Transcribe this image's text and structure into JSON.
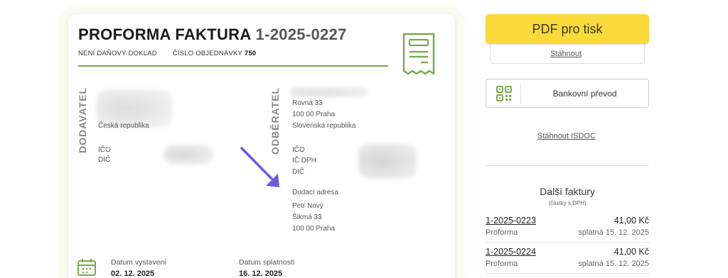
{
  "invoice": {
    "title": "PROFORMA FAKTURA",
    "number": "1-2025-0227",
    "not_tax_doc": "NENÍ DAŇOVÝ DOKLAD",
    "order_label": "ČÍSLO OBJEDNÁVKY",
    "order_number": "750",
    "supplier": {
      "heading": "DODAVATEL",
      "country": "Česká republika",
      "ico_label": "IČO",
      "dic_label": "DIČ"
    },
    "customer": {
      "heading": "ODBĚRATEL",
      "street": "Rovná 33",
      "city": "100 00 Praha",
      "country": "Slovenská republika",
      "ico_label": "IČO",
      "icdph_label": "IČ DPH",
      "dic_label": "DIČ",
      "delivery_label": "Dodací adresa",
      "delivery_name": "Petr Nový",
      "delivery_street": "Šikmá 33",
      "delivery_city": "100 00 Praha"
    },
    "dates": {
      "issued_label": "Datum vystavení",
      "issued_value": "02. 12. 2025",
      "due_label": "Datum splatnosti",
      "due_value": "16. 12. 2025"
    }
  },
  "sidebar": {
    "pdf_button": "PDF pro tisk",
    "download_link": "Stáhnout",
    "bank_button": "Bankovní převod",
    "isdoc_link": "Stáhnout ISDOC",
    "more_title": "Další faktury",
    "more_subtitle": "(částky s DPH)",
    "invoices": [
      {
        "number": "1-2025-0223",
        "amount": "41,00 Kč",
        "type": "Proforma",
        "due": "splatná 15. 12. 2025"
      },
      {
        "number": "1-2025-0224",
        "amount": "41,00 Kč",
        "type": "Proforma",
        "due": "splatná 15. 12. 2025"
      }
    ]
  },
  "colors": {
    "accent_green": "#7aa84a",
    "button_yellow": "#fada3a",
    "arrow_purple": "#6a5ae0"
  }
}
